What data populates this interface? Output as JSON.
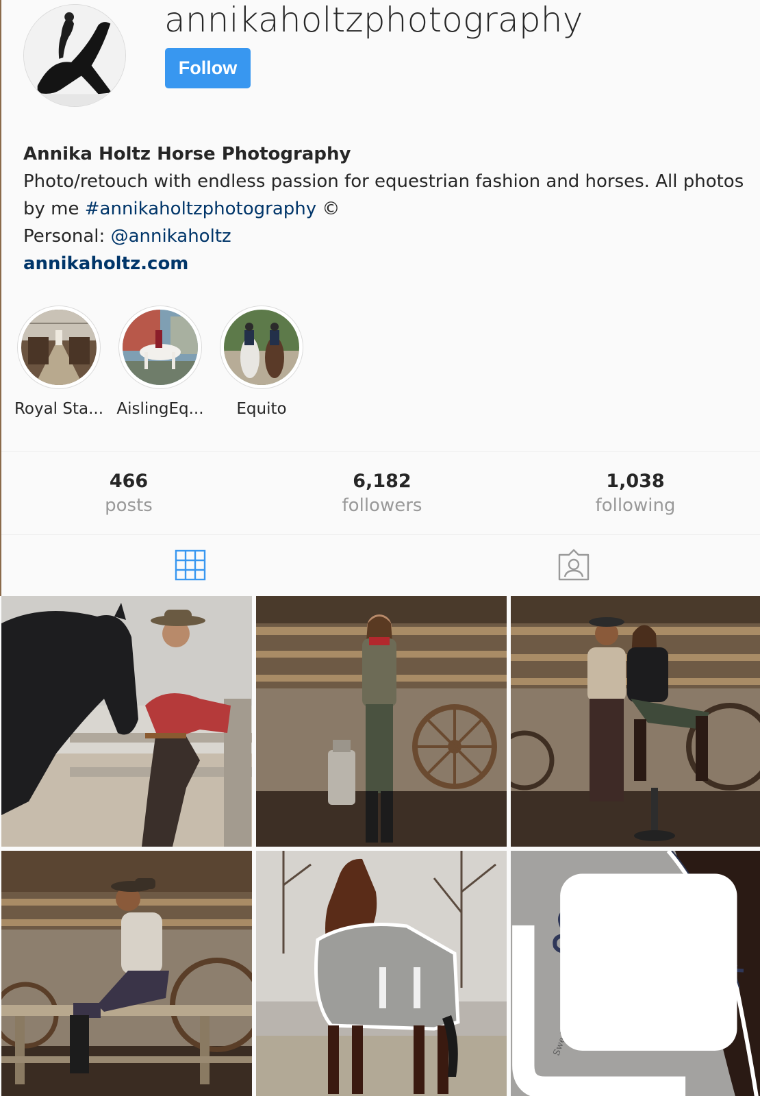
{
  "profile": {
    "username": "annikaholtzphotography",
    "follow_label": "Follow",
    "avatar_icon": "profile-avatar"
  },
  "bio": {
    "name": "Annika Holtz Horse Photography",
    "line1": "Photo/retouch with endless passion for equestrian fashion and horses. All photos",
    "line2_prefix": "by me ",
    "hashtag": "#annikaholtzphotography",
    "line2_suffix": " ©",
    "personal_prefix": "Personal: ",
    "mention": "@annikaholtz",
    "website": "annikaholtz.com"
  },
  "highlights": [
    {
      "label": "Royal Sta..."
    },
    {
      "label": "AislingEq..."
    },
    {
      "label": "Equito"
    }
  ],
  "stats": {
    "posts_count": "466",
    "posts_label": "posts",
    "followers_count": "6,182",
    "followers_label": "followers",
    "following_count": "1,038",
    "following_label": "following"
  },
  "tabs": {
    "posts_icon": "grid-icon",
    "tagged_icon": "tagged-icon",
    "active_color": "#3897f0",
    "inactive_color": "#999999"
  },
  "colors": {
    "accent": "#3897f0",
    "link": "#003569",
    "text": "#262626",
    "muted": "#999999"
  },
  "posts": [
    {
      "id": "post-1",
      "multi": false
    },
    {
      "id": "post-2",
      "multi": false
    },
    {
      "id": "post-3",
      "multi": false
    },
    {
      "id": "post-4",
      "multi": false
    },
    {
      "id": "post-5",
      "multi": false
    },
    {
      "id": "post-6",
      "multi": true
    }
  ]
}
